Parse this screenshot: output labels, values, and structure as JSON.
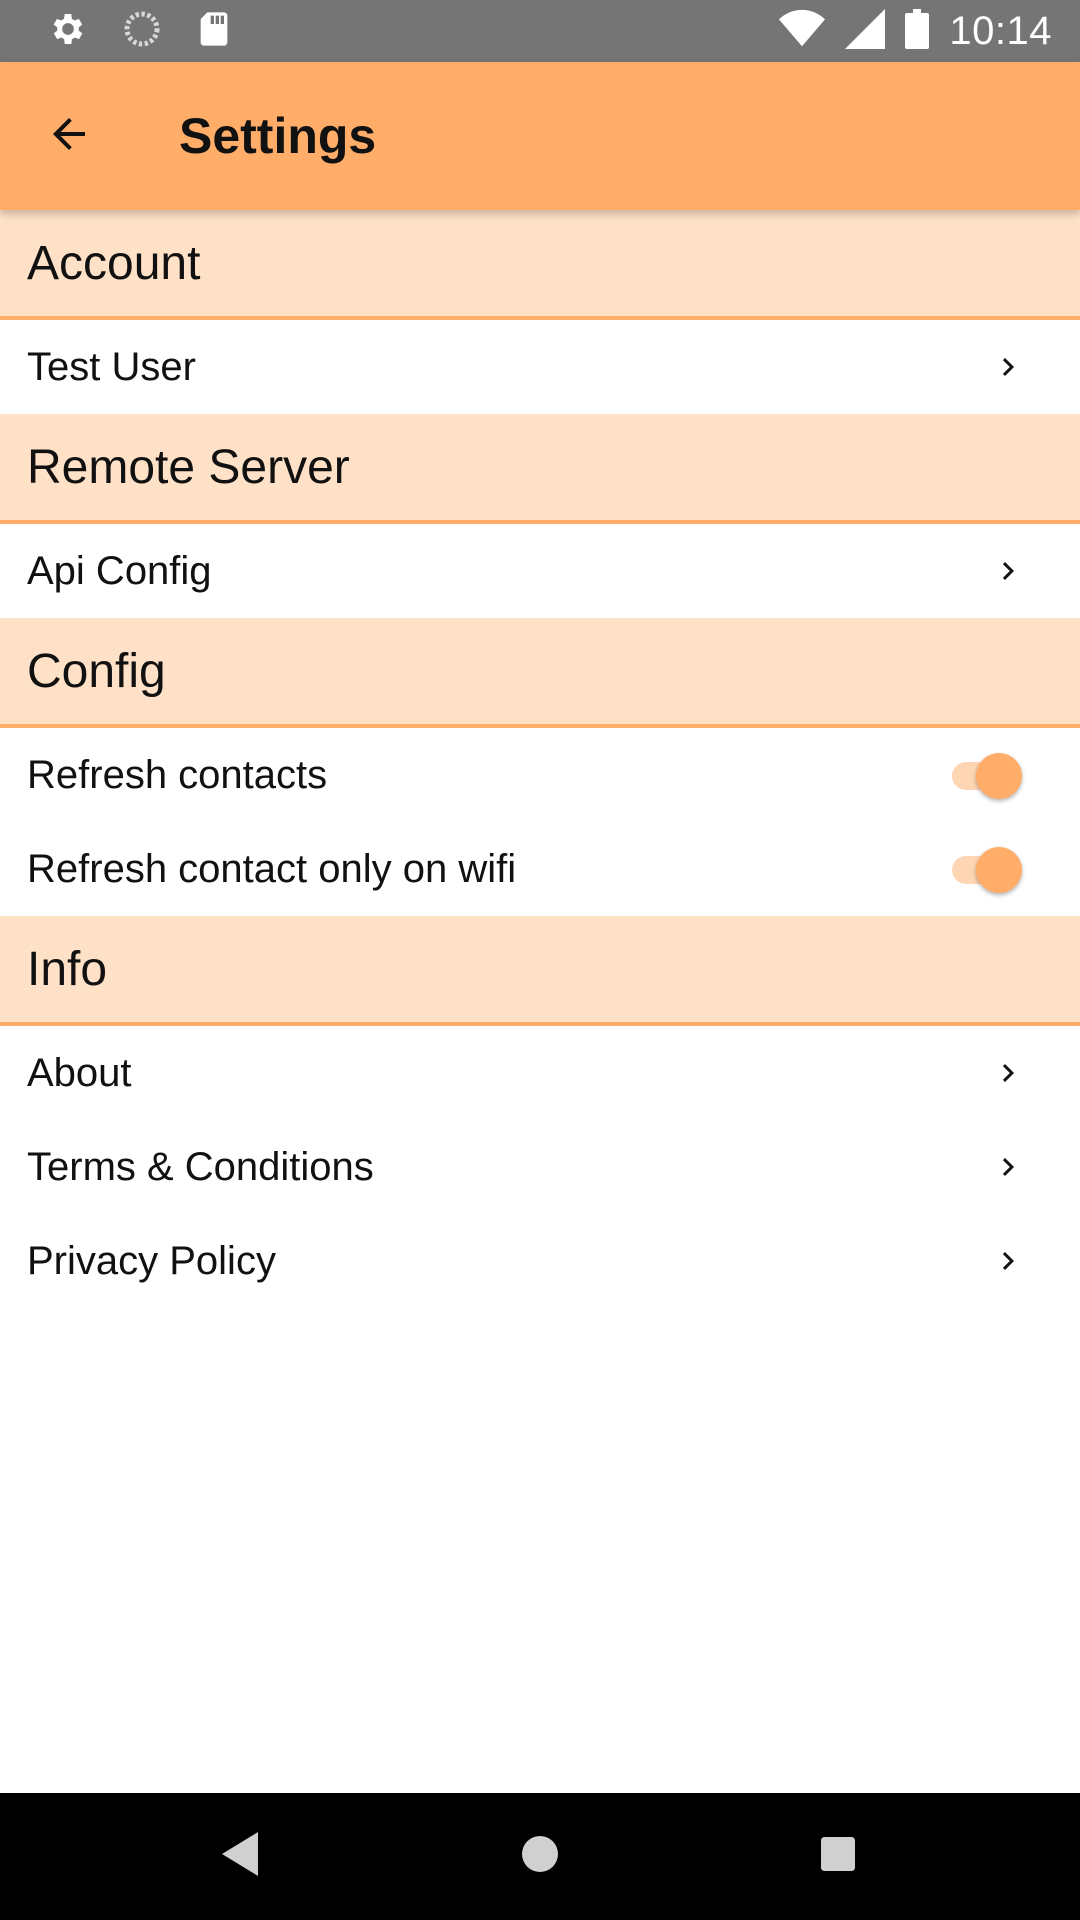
{
  "status_bar": {
    "time": "10:14",
    "left_icons": [
      "gear-icon",
      "loading-circle-icon",
      "sd-card-icon"
    ],
    "right_icons": [
      "wifi-icon",
      "cell-signal-icon",
      "battery-icon"
    ]
  },
  "app_bar": {
    "title": "Settings",
    "back_icon": "arrow-left-icon"
  },
  "sections": [
    {
      "header": "Account",
      "items": [
        {
          "label": "Test User",
          "control": "chevron"
        }
      ]
    },
    {
      "header": "Remote Server",
      "items": [
        {
          "label": "Api Config",
          "control": "chevron"
        }
      ]
    },
    {
      "header": "Config",
      "items": [
        {
          "label": "Refresh contacts",
          "control": "toggle",
          "on": true
        },
        {
          "label": "Refresh contact only on wifi",
          "control": "toggle",
          "on": true
        }
      ]
    },
    {
      "header": "Info",
      "items": [
        {
          "label": "About",
          "control": "chevron"
        },
        {
          "label": "Terms & Conditions",
          "control": "chevron"
        },
        {
          "label": "Privacy Policy",
          "control": "chevron"
        }
      ]
    }
  ],
  "colors": {
    "accent": "#FFAD69",
    "section_bg": "#FFE1C7",
    "status_bar": "#757575",
    "nav_bar": "#000000"
  },
  "nav_bar": {
    "icons": [
      "nav-back-icon",
      "nav-home-icon",
      "nav-recents-icon"
    ]
  }
}
